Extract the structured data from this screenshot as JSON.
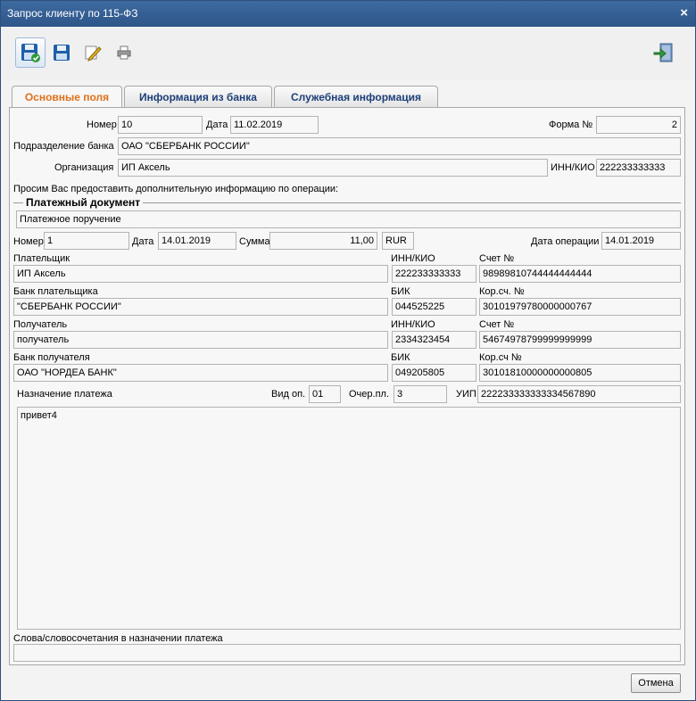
{
  "window": {
    "title": "Запрос клиенту по 115-ФЗ",
    "close_icon": "×"
  },
  "toolbar": {
    "buttons": [
      {
        "icon": "save-and-sign-icon",
        "active": true
      },
      {
        "icon": "save-icon",
        "active": false
      },
      {
        "icon": "edit-pencil-icon",
        "active": false
      },
      {
        "icon": "print-icon",
        "active": false
      },
      {
        "icon": "exit-door-icon",
        "active": false
      }
    ]
  },
  "tabs": [
    {
      "label": "Основные поля",
      "active": true
    },
    {
      "label": "Информация из банка",
      "active": false
    },
    {
      "label": "Служебная информация",
      "active": false
    }
  ],
  "header": {
    "number_label": "Номер",
    "number": "10",
    "date_label": "Дата",
    "date": "11.02.2019",
    "form_label": "Форма №",
    "form": "2",
    "division_label": "Подразделение банка",
    "division": "ОАО \"СБЕРБАНК РОССИИ\"",
    "org_label": "Организация",
    "org": "ИП Аксель",
    "inn_label": "ИНН/КИО",
    "inn": "222233333333",
    "request_text": "Просим Вас предоставить дополнительную информацию по операции:"
  },
  "payment": {
    "group_label": "Платежный документ",
    "doc_type": "Платежное поручение",
    "number_label": "Номер",
    "number": "1",
    "date_label": "Дата",
    "date": "14.01.2019",
    "sum_label": "Сумма",
    "sum": "11,00",
    "currency": "RUR",
    "op_date_label": "Дата операции",
    "op_date": "14.01.2019",
    "payer_label": "Плательщик",
    "payer": "ИП Аксель",
    "payer_inn_label": "ИНН/КИО",
    "payer_inn": "222233333333",
    "payer_acc_label": "Счет №",
    "payer_acc": "98989810744444444444",
    "payer_bank_label": "Банк плательщика",
    "payer_bank": "\"СБЕРБАНК РОССИИ\"",
    "payer_bik_label": "БИК",
    "payer_bik": "044525225",
    "payer_corr_label": "Кор.сч. №",
    "payer_corr": "30101979780000000767",
    "recipient_label": "Получатель",
    "recipient": "получатель",
    "recipient_inn_label": "ИНН/КИО",
    "recipient_inn": "2334323454",
    "recipient_acc_label": "Счет №",
    "recipient_acc": "54674978799999999999",
    "recipient_bank_label": "Банк получателя",
    "recipient_bank": "ОАО \"НОРДЕА БАНК\"",
    "recipient_bik_label": "БИК",
    "recipient_bik": "049205805",
    "recipient_corr_label": "Кор.сч №",
    "recipient_corr": "30101810000000000805",
    "purpose_label": "Назначение платежа",
    "op_type_label": "Вид оп.",
    "op_type": "01",
    "priority_label": "Очер.пл.",
    "priority": "3",
    "uip_label": "УИП",
    "uip": "222233333333334567890",
    "purpose": "привет4",
    "keywords_label": "Слова/словосочетания в назначении платежа",
    "keywords": ""
  },
  "footer": {
    "cancel_label": "Отмена"
  }
}
